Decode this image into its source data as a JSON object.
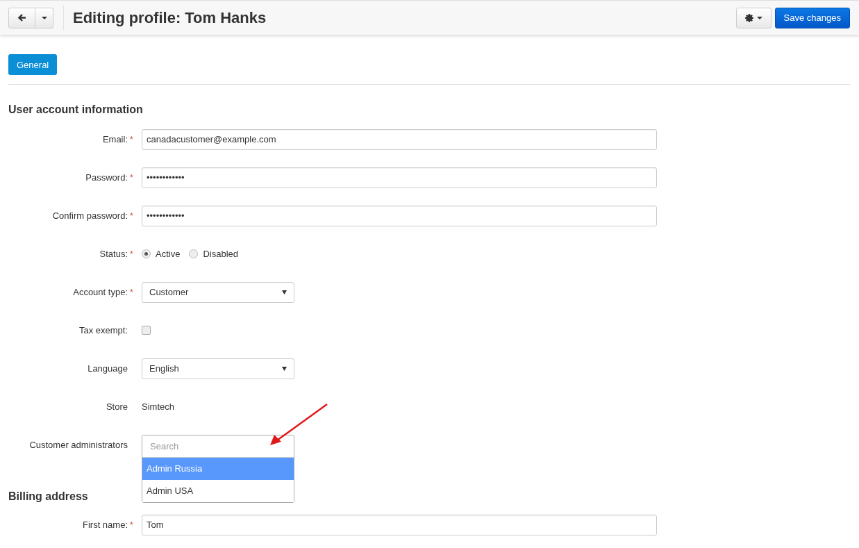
{
  "header": {
    "title": "Editing profile: Tom Hanks",
    "save_button": "Save changes"
  },
  "tabs": [
    {
      "label": "General",
      "selected": true
    }
  ],
  "sections": [
    {
      "title": "User account information",
      "fields": [
        {
          "kind": "text",
          "label": "Email:",
          "mark": "*",
          "value": "canadacustomer@example.com"
        },
        {
          "kind": "text",
          "label": "Password:",
          "mark": "*",
          "value": "••••••••••••"
        },
        {
          "kind": "text",
          "label": "Confirm password:",
          "mark": "*",
          "value": "••••••••••••"
        },
        {
          "kind": "radio",
          "label": "Status:",
          "mark": "*",
          "options": [
            {
              "label": "Active",
              "selected": true
            },
            {
              "label": "Disabled",
              "selected": false
            }
          ]
        },
        {
          "kind": "select",
          "label": "Account type:",
          "mark": "*",
          "value": "Customer"
        },
        {
          "kind": "checkbox",
          "label": "Tax exempt:",
          "checked": false
        },
        {
          "kind": "select",
          "label": "Language",
          "value": "English"
        },
        {
          "kind": "static",
          "label": "Store",
          "value": "Simtech"
        },
        {
          "kind": "multiselect",
          "label": "Customer administrators",
          "placeholder": "Search",
          "options": [
            {
              "label": "Admin Russia",
              "selected": true
            },
            {
              "label": "Admin USA",
              "selected": false
            }
          ]
        }
      ]
    },
    {
      "title": "Billing address",
      "fields": [
        {
          "kind": "text",
          "label": "First name:",
          "mark": "*",
          "value": "Tom"
        }
      ]
    }
  ]
}
